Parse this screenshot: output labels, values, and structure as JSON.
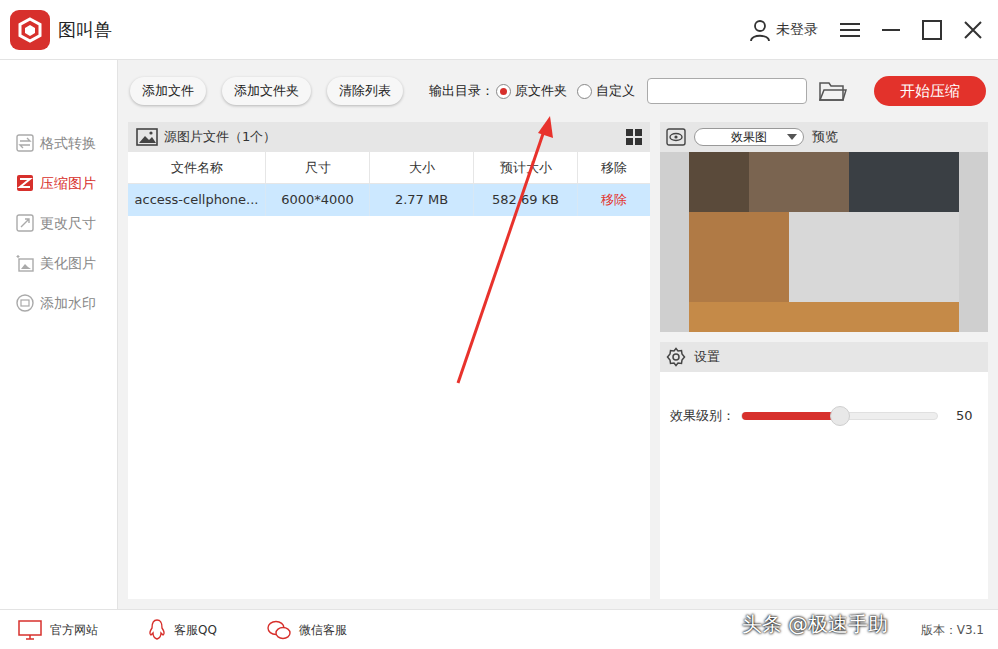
{
  "app": {
    "title": "图叫兽",
    "user": "未登录"
  },
  "sidebar": {
    "items": [
      {
        "label": "格式转换",
        "selected": false
      },
      {
        "label": "压缩图片",
        "selected": true
      },
      {
        "label": "更改尺寸",
        "selected": false
      },
      {
        "label": "美化图片",
        "selected": false
      },
      {
        "label": "添加水印",
        "selected": false
      }
    ]
  },
  "toolbar": {
    "buttons": [
      "添加文件",
      "添加文件夹",
      "清除列表"
    ],
    "output_label": "输出目录：",
    "output_options": [
      {
        "label": "原文件夹",
        "selected": true
      },
      {
        "label": "自定义",
        "selected": false
      }
    ],
    "path": {
      "value": ""
    },
    "start_button": "开始压缩"
  },
  "file_panel": {
    "title": "源图片文件（1个）",
    "columns": [
      "文件名称",
      "尺寸",
      "大小",
      "预计大小",
      "移除"
    ],
    "rows": [
      {
        "cells": [
          "access-cellphone...",
          "6000*4000",
          "2.77 MB",
          "582.69 KB",
          "移除"
        ],
        "selected": true
      }
    ]
  },
  "preview": {
    "mode": "效果图",
    "label": "预览"
  },
  "settings": {
    "title": "设置",
    "slider": {
      "label": "效果级别：",
      "level": 0.5,
      "reading": "50"
    }
  },
  "footer": {
    "links": [
      "官方网站",
      "客服QQ",
      "微信客服"
    ],
    "version": "版本：V3.1"
  },
  "watermark": "头条 @极速手助"
}
